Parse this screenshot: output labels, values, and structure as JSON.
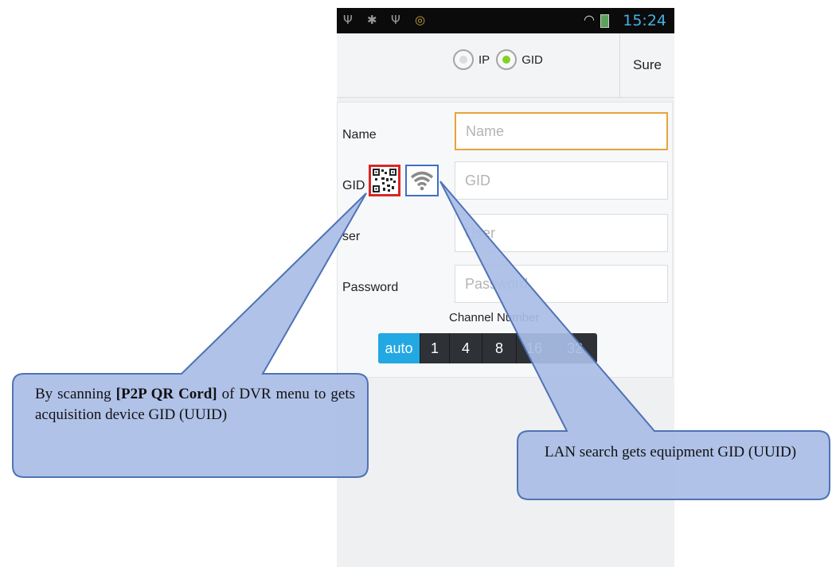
{
  "status_bar": {
    "icons": [
      "usb-icon",
      "android-debug-icon",
      "usb-icon",
      "app-icon",
      "wifi-icon",
      "battery-icon"
    ],
    "time": "15:24"
  },
  "top_bar": {
    "options": [
      {
        "label": "IP",
        "checked": false
      },
      {
        "label": "GID",
        "checked": true
      }
    ],
    "confirm_label": "Sure"
  },
  "form": {
    "name": {
      "label": "Name",
      "placeholder": "Name"
    },
    "gid": {
      "label": "GID",
      "placeholder": "GID"
    },
    "user": {
      "label": "ser",
      "placeholder": "User"
    },
    "password": {
      "label": "Password",
      "placeholder": "Password"
    },
    "channel": {
      "label": "Channel Number",
      "options": [
        "auto",
        "1",
        "4",
        "8",
        "16",
        "32"
      ],
      "selected": "auto"
    }
  },
  "callouts": {
    "qr": {
      "text_before": "By scanning ",
      "bold": "[P2P QR Cord]",
      "text_after": " of DVR menu to gets acquisition device GID (UUID)"
    },
    "lan": {
      "text": "LAN search gets equipment GID (UUID)"
    }
  },
  "colors": {
    "accent_blue": "#22a8e2",
    "focus_orange": "#e8a33b",
    "radio_green": "#7ed321",
    "qr_border_red": "#d92626",
    "wifi_border_blue": "#3f6fc4",
    "callout_fill": "#a9bde6",
    "callout_stroke": "#4f73b5"
  }
}
